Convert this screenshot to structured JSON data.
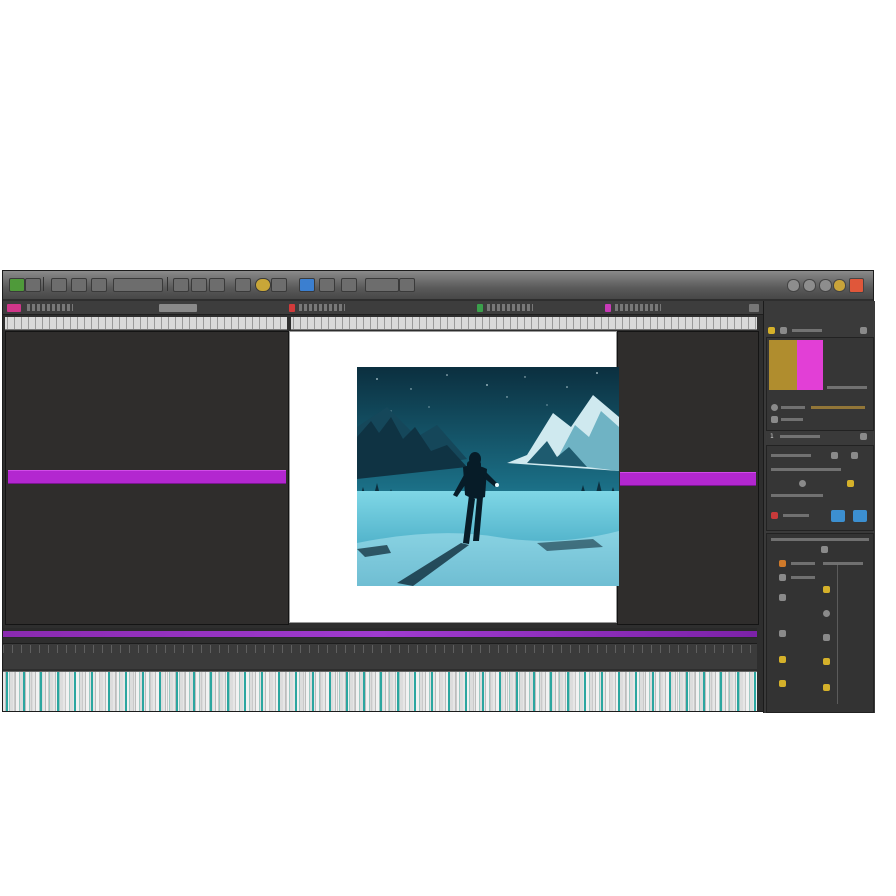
{
  "window": {
    "title": "",
    "accent": "#b327d0",
    "timeline_color": "#9a34c6",
    "waveform_color": "#2aa6a0"
  },
  "toolbar": {
    "buttons": [
      "record-button",
      "undo-button",
      "redo-button",
      "grid-button",
      "snap-button",
      "layout-button",
      "cut-button",
      "link-button",
      "render-button",
      "preview-button",
      "export-button",
      "blue-square-button",
      "clip-button",
      "settings-button",
      "arrow-button",
      "loop-button",
      "expand-button"
    ]
  },
  "panels": {
    "tabs": [
      "source-tab",
      "program-tab",
      "effects-tab",
      "audio-tab"
    ],
    "viewer_left": "source-viewer",
    "viewer_right": "reference-viewer"
  },
  "canvas": {
    "image_subject": "hiker-in-snowy-valley"
  },
  "side_panel": {
    "header_icons": [
      "color-icon",
      "lock-icon",
      "expand-icon"
    ],
    "swatch_colors": [
      "#b08d2e",
      "#e23fd6"
    ],
    "counter": "1",
    "sections": [
      "color-section",
      "properties-section",
      "layers-section"
    ]
  }
}
